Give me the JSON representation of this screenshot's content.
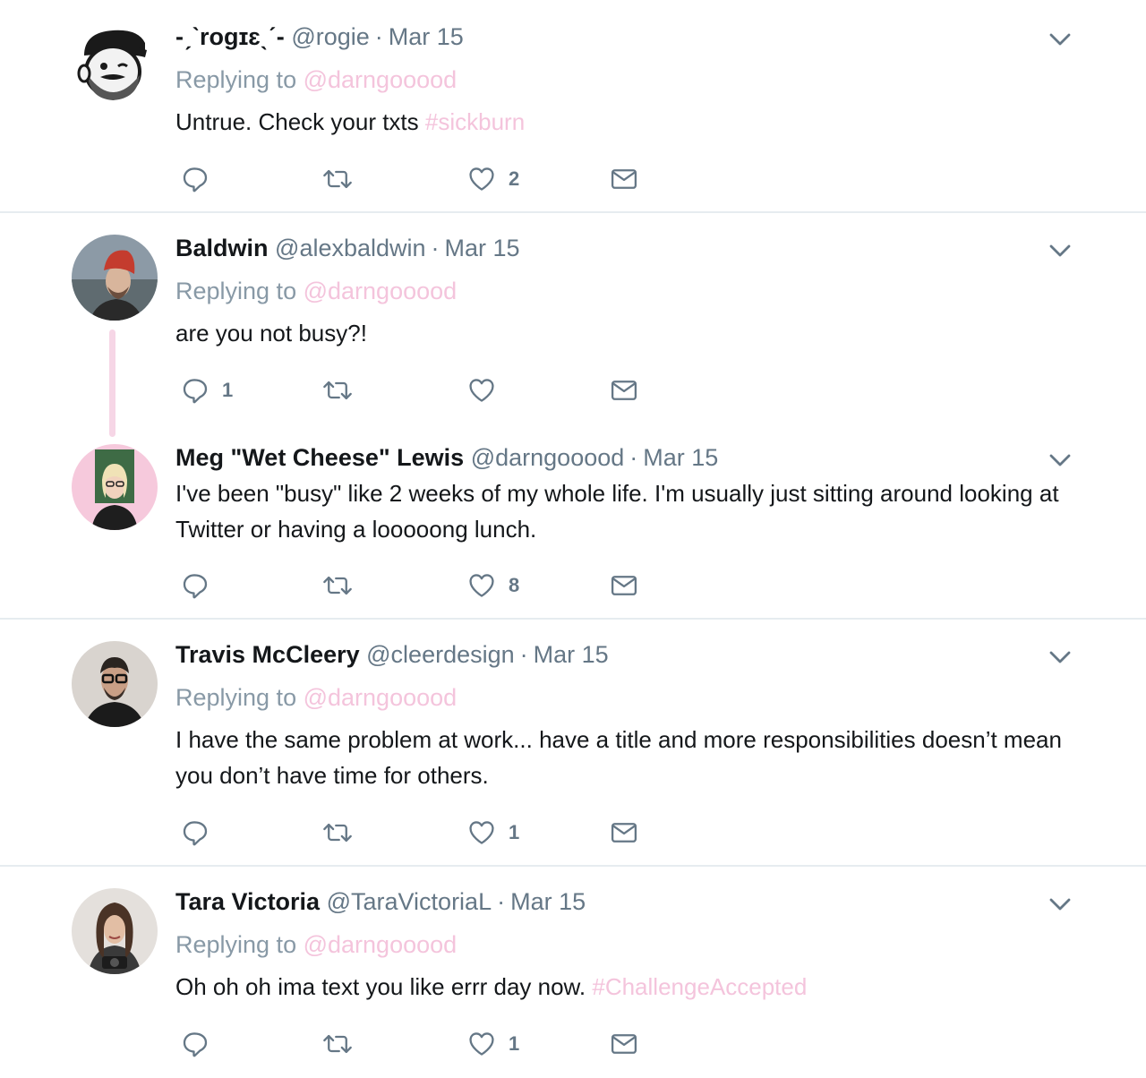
{
  "tweets": [
    {
      "name": "-ˏˋrogɪɛˎˊ-",
      "handle": "@rogie",
      "date": "Mar 15",
      "replying_label": "Replying to",
      "replying_to": "@darngooood",
      "text": "Untrue. Check your txts",
      "hashtag": "#sickburn",
      "reply_count": "",
      "like_count": "2"
    },
    {
      "name": "Baldwin",
      "handle": "@alexbaldwin",
      "date": "Mar 15",
      "replying_label": "Replying to",
      "replying_to": "@darngooood",
      "text": "are you not busy?!",
      "hashtag": "",
      "reply_count": "1",
      "like_count": ""
    },
    {
      "name": "Meg \"Wet Cheese\" Lewis",
      "handle": "@darngooood",
      "date": "Mar 15",
      "text": "I've been \"busy\" like 2 weeks of my whole life. I'm usually just sitting around looking at Twitter or having a looooong lunch.",
      "reply_count": "",
      "like_count": "8"
    },
    {
      "name": "Travis McCleery",
      "handle": "@cleerdesign",
      "date": "Mar 15",
      "replying_label": "Replying to",
      "replying_to": "@darngooood",
      "text": "I have the same problem at work... have a title and more responsibilities doesn’t mean you don’t have time for others.",
      "reply_count": "",
      "like_count": "1"
    },
    {
      "name": "Tara Victoria",
      "handle": "@TaraVictoriaL",
      "date": "Mar 15",
      "replying_label": "Replying to",
      "replying_to": "@darngooood",
      "text": "Oh oh oh ima text you like errr day now.",
      "hashtag": "#ChallengeAccepted",
      "reply_count": "",
      "like_count": "1"
    }
  ],
  "separator": "·",
  "icons": {
    "reply": "reply-icon",
    "retweet": "retweet-icon",
    "like": "heart-icon",
    "dm": "envelope-icon",
    "more": "chevron-down-icon"
  },
  "colors": {
    "text": "#14171a",
    "muted": "#657786",
    "mention_pink": "#f4c4dc",
    "divider": "#e6ecf0",
    "thread_line": "#f6d6e6"
  }
}
